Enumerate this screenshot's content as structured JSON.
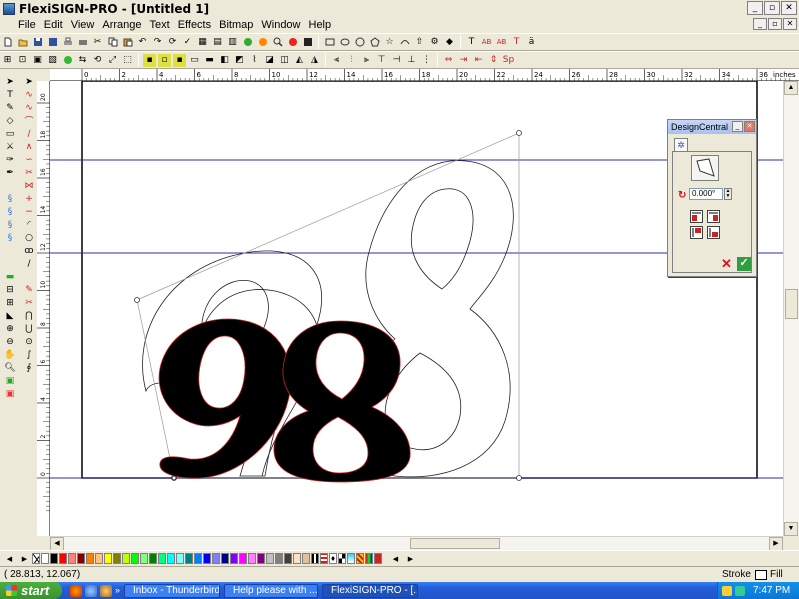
{
  "window": {
    "title": "FlexiSIGN-PRO - [Untitled 1]"
  },
  "menu": [
    "File",
    "Edit",
    "View",
    "Arrange",
    "Text",
    "Effects",
    "Bitmap",
    "Window",
    "Help"
  ],
  "ruler": {
    "units": "inches",
    "h_ticks": [
      "0",
      "2",
      "4",
      "6",
      "8",
      "10",
      "12",
      "14",
      "16",
      "18",
      "20",
      "22",
      "24",
      "26",
      "28",
      "30",
      "32",
      "34",
      "36"
    ],
    "v_ticks": [
      "20",
      "18",
      "16",
      "14",
      "12",
      "10",
      "8",
      "6",
      "4",
      "2",
      "0"
    ]
  },
  "canvas": {
    "text_black": "98",
    "text_outline": "98",
    "fill_color": "#000000",
    "guide_color": "#2d2da8",
    "edge_color": "#cc2222"
  },
  "design_central": {
    "title": "DesignCentral",
    "angle": "0.000°"
  },
  "status": {
    "coords": "(   28.813,     12.067)",
    "stroke_label": "Stroke",
    "fill_label": "Fill"
  },
  "taskbar": {
    "start": "start",
    "tasks": [
      "Inbox - Thunderbird",
      "Help please with ...",
      "FlexiSIGN-PRO - [..."
    ],
    "clock": "7:47 PM"
  },
  "palette_colors": [
    "#ffffff",
    "#000000",
    "#ff0000",
    "#ff8080",
    "#800000",
    "#ff8000",
    "#ffc080",
    "#ffff00",
    "#808000",
    "#c0ff00",
    "#00ff00",
    "#80ff80",
    "#008000",
    "#00ff80",
    "#00ffff",
    "#80ffff",
    "#008080",
    "#0080ff",
    "#0000ff",
    "#8080ff",
    "#000080",
    "#8000ff",
    "#ff00ff",
    "#ff80ff",
    "#800080",
    "#c0c0c0",
    "#808080",
    "#404040",
    "#ffe0c0",
    "#e0c0a0"
  ]
}
